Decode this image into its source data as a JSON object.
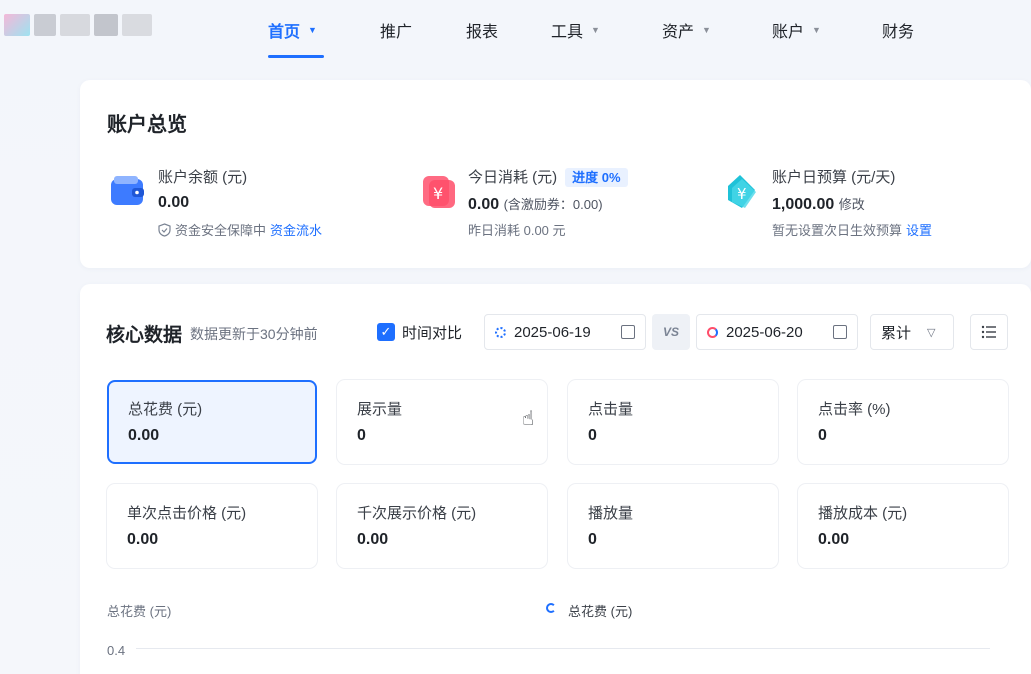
{
  "nav": {
    "items": [
      {
        "label": "首页",
        "caret": true,
        "active": true
      },
      {
        "label": "推广",
        "caret": false
      },
      {
        "label": "报表",
        "caret": false
      },
      {
        "label": "工具",
        "caret": true
      },
      {
        "label": "资产",
        "caret": true
      },
      {
        "label": "账户",
        "caret": true
      },
      {
        "label": "财务",
        "caret": false
      }
    ]
  },
  "overview": {
    "title": "账户总览",
    "balance": {
      "label": "账户余额 (元)",
      "value": "0.00",
      "sub_text": "资金安全保障中",
      "sub_link": "资金流水",
      "icon": "wallet-icon"
    },
    "spend": {
      "label": "今日消耗 (元)",
      "badge": "进度 0%",
      "value": "0.00",
      "value_note": "(含激励券：0.00)",
      "sub_text": "昨日消耗 0.00 元",
      "icon": "yuan-tag-icon"
    },
    "budget": {
      "label": "账户日预算 (元/天)",
      "value": "1,000.00",
      "value_link": "修改",
      "sub_text": "暂无设置次日生效预算",
      "sub_link": "设置",
      "icon": "yuan-price-tag-icon"
    }
  },
  "core": {
    "title": "核心数据",
    "hint": "数据更新于30分钟前",
    "compare_label": "时间对比",
    "date_a": "2025-06-19",
    "vs": "VS",
    "date_b": "2025-06-20",
    "mode": "累计",
    "metrics": [
      {
        "label": "总花费 (元)",
        "value": "0.00"
      },
      {
        "label": "展示量",
        "value": "0"
      },
      {
        "label": "点击量",
        "value": "0"
      },
      {
        "label": "点击率 (%)",
        "value": "0"
      },
      {
        "label": "单次点击价格 (元)",
        "value": "0.00"
      },
      {
        "label": "千次展示价格 (元)",
        "value": "0.00"
      },
      {
        "label": "播放量",
        "value": "0"
      },
      {
        "label": "播放成本 (元)",
        "value": "0.00"
      }
    ],
    "chart": {
      "ylabel": "总花费 (元)",
      "legend": "总花费 (元)",
      "tick": "0.4"
    }
  },
  "colors": {
    "accent": "#1e6fff",
    "wallet": "#3d7bff",
    "spend": "#ff4d6a",
    "budget": "#1fc2d8"
  }
}
